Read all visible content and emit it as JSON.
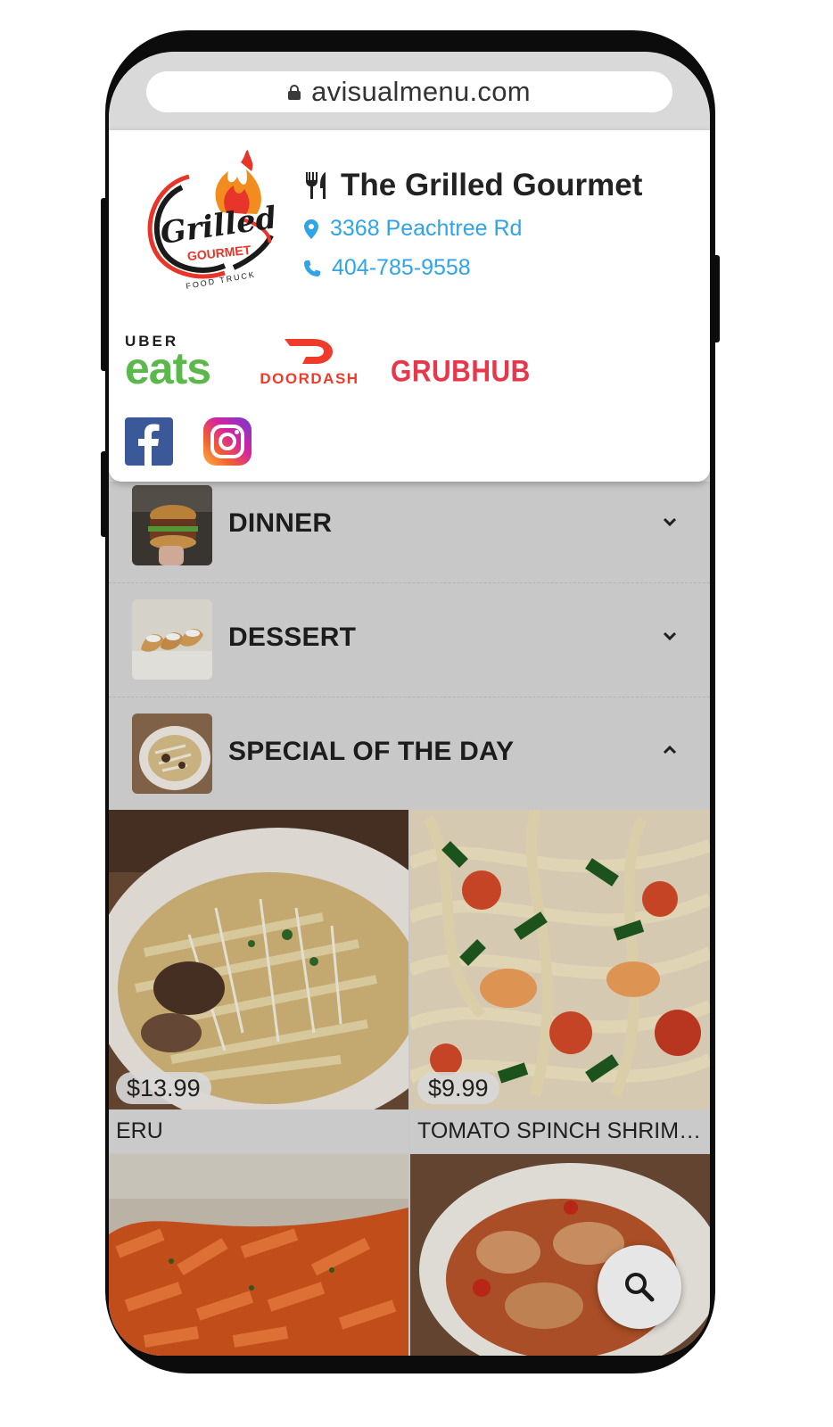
{
  "browser": {
    "url": "avisualmenu.com",
    "lock_icon": "lock-icon"
  },
  "restaurant": {
    "logo": {
      "icon": "grilled-gourmet-logo",
      "line1": "Grilled",
      "line2": "GOURMET",
      "line3": "FOOD TRUCK"
    },
    "name": "The Grilled Gourmet",
    "name_icon": "fork-knife-icon",
    "address": "3368 Peachtree Rd",
    "address_icon": "location-pin-icon",
    "phone": "404-785-9558",
    "phone_icon": "phone-icon",
    "accent_color": "#2fa4e7"
  },
  "delivery": {
    "uber_top": "UBER",
    "uber_bottom": "eats",
    "doordash": "DOORDASH",
    "grubhub": "GRUBHUB"
  },
  "social": [
    {
      "name": "facebook",
      "icon": "facebook-icon"
    },
    {
      "name": "instagram",
      "icon": "instagram-icon"
    }
  ],
  "categories": [
    {
      "label": "DINNER",
      "expanded": false,
      "icon": "chevron-down-icon"
    },
    {
      "label": "DESSERT",
      "expanded": false,
      "icon": "chevron-down-icon"
    },
    {
      "label": "SPECIAL OF THE DAY",
      "expanded": true,
      "icon": "chevron-up-icon"
    }
  ],
  "items": [
    {
      "name": "ERU",
      "price": "$13.99"
    },
    {
      "name": "TOMATO SPINCH SHRIMP PASTA",
      "price": "$9.99"
    },
    {
      "name": "",
      "price": ""
    },
    {
      "name": "",
      "price": ""
    }
  ],
  "search_fab_icon": "search-icon"
}
